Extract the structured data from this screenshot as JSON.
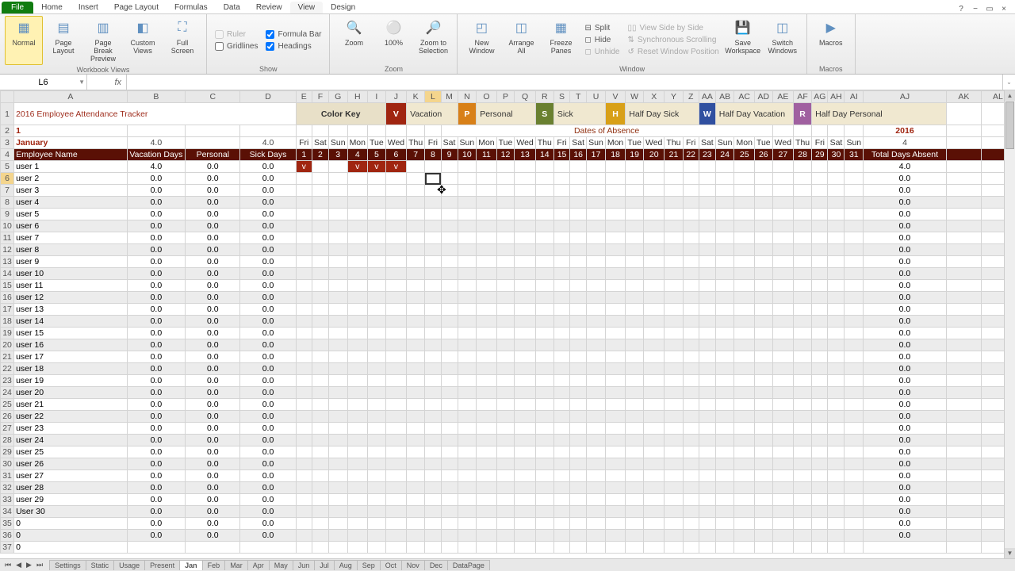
{
  "tabs": [
    "File",
    "Home",
    "Insert",
    "Page Layout",
    "Formulas",
    "Data",
    "Review",
    "View",
    "Design"
  ],
  "active_tab": "View",
  "ribbon": {
    "workbook_views": {
      "label": "Workbook Views",
      "normal": "Normal",
      "page_layout": "Page\nLayout",
      "page_break": "Page Break\nPreview",
      "custom": "Custom\nViews",
      "full": "Full\nScreen"
    },
    "show": {
      "label": "Show",
      "ruler": "Ruler",
      "formula_bar": "Formula Bar",
      "gridlines": "Gridlines",
      "headings": "Headings"
    },
    "zoom": {
      "label": "Zoom",
      "zoom": "Zoom",
      "hundred": "100%",
      "to_sel": "Zoom to\nSelection"
    },
    "window": {
      "label": "Window",
      "new": "New\nWindow",
      "arrange": "Arrange\nAll",
      "freeze": "Freeze\nPanes",
      "split": "Split",
      "hide": "Hide",
      "unhide": "Unhide",
      "side": "View Side by Side",
      "sync": "Synchronous Scrolling",
      "reset": "Reset Window Position",
      "save": "Save\nWorkspace",
      "switch": "Switch\nWindows"
    },
    "macros": {
      "label": "Macros",
      "macros": "Macros"
    }
  },
  "namebox": "L6",
  "formula": "",
  "cols": [
    "A",
    "B",
    "C",
    "D",
    "E",
    "F",
    "G",
    "H",
    "I",
    "J",
    "K",
    "L",
    "M",
    "N",
    "O",
    "P",
    "Q",
    "R",
    "S",
    "T",
    "U",
    "V",
    "W",
    "X",
    "Y",
    "Z",
    "AA",
    "AB",
    "AC",
    "AD",
    "AE",
    "AF",
    "AG",
    "AH",
    "AI",
    "AJ",
    "AK",
    "AL"
  ],
  "title": "2016 Employee Attendance Tracker",
  "color_key": "Color Key",
  "keys": [
    {
      "code": "V",
      "label": "Vacation",
      "cls": "key-v"
    },
    {
      "code": "P",
      "label": "Personal",
      "cls": "key-p"
    },
    {
      "code": "S",
      "label": "Sick",
      "cls": "key-s"
    },
    {
      "code": "H",
      "label": "Half Day Sick",
      "cls": "key-h"
    },
    {
      "code": "W",
      "label": "Half Day Vacation",
      "cls": "key-w"
    },
    {
      "code": "R",
      "label": "Half Day Personal",
      "cls": "key-r"
    }
  ],
  "monthnum": "1",
  "monthname": "January",
  "dates_header": "Dates of Absence",
  "year": "2016",
  "floats": {
    "b": "4.0",
    "d": "4.0",
    "aj": "4"
  },
  "dow": [
    "Fri",
    "Sat",
    "Sun",
    "Mon",
    "Tue",
    "Wed",
    "Thu",
    "Fri",
    "Sat",
    "Sun",
    "Mon",
    "Tue",
    "Wed",
    "Thu",
    "Fri",
    "Sat",
    "Sun",
    "Mon",
    "Tue",
    "Wed",
    "Thu",
    "Fri",
    "Sat",
    "Sun",
    "Mon",
    "Tue",
    "Wed",
    "Thu",
    "Fri",
    "Sat",
    "Sun"
  ],
  "headers": {
    "name": "Employee Name",
    "vac": "Vacation Days",
    "per": "Personal",
    "sick": "Sick Days",
    "total": "Total Days Absent"
  },
  "days": [
    "1",
    "2",
    "3",
    "4",
    "5",
    "6",
    "7",
    "8",
    "9",
    "10",
    "11",
    "12",
    "13",
    "14",
    "15",
    "16",
    "17",
    "18",
    "19",
    "20",
    "21",
    "22",
    "23",
    "24",
    "25",
    "26",
    "27",
    "28",
    "29",
    "30",
    "31"
  ],
  "rows": [
    {
      "r": 5,
      "name": "user 1",
      "vac": "4.0",
      "per": "0.0",
      "sick": "0.0",
      "marks": {
        "0": "v",
        "3": "v",
        "4": "v",
        "5": "v"
      },
      "total": "4.0"
    },
    {
      "r": 6,
      "name": "user 2",
      "vac": "0.0",
      "per": "0.0",
      "sick": "0.0",
      "marks": {},
      "total": "0.0",
      "sel": true
    },
    {
      "r": 7,
      "name": "user 3",
      "vac": "0.0",
      "per": "0.0",
      "sick": "0.0",
      "marks": {},
      "total": "0.0"
    },
    {
      "r": 8,
      "name": "user 4",
      "vac": "0.0",
      "per": "0.0",
      "sick": "0.0",
      "marks": {},
      "total": "0.0"
    },
    {
      "r": 9,
      "name": "user 5",
      "vac": "0.0",
      "per": "0.0",
      "sick": "0.0",
      "marks": {},
      "total": "0.0"
    },
    {
      "r": 10,
      "name": "user 6",
      "vac": "0.0",
      "per": "0.0",
      "sick": "0.0",
      "marks": {},
      "total": "0.0"
    },
    {
      "r": 11,
      "name": "user 7",
      "vac": "0.0",
      "per": "0.0",
      "sick": "0.0",
      "marks": {},
      "total": "0.0"
    },
    {
      "r": 12,
      "name": "user 8",
      "vac": "0.0",
      "per": "0.0",
      "sick": "0.0",
      "marks": {},
      "total": "0.0"
    },
    {
      "r": 13,
      "name": "user 9",
      "vac": "0.0",
      "per": "0.0",
      "sick": "0.0",
      "marks": {},
      "total": "0.0"
    },
    {
      "r": 14,
      "name": "user 10",
      "vac": "0.0",
      "per": "0.0",
      "sick": "0.0",
      "marks": {},
      "total": "0.0"
    },
    {
      "r": 15,
      "name": "user 11",
      "vac": "0.0",
      "per": "0.0",
      "sick": "0.0",
      "marks": {},
      "total": "0.0"
    },
    {
      "r": 16,
      "name": "user 12",
      "vac": "0.0",
      "per": "0.0",
      "sick": "0.0",
      "marks": {},
      "total": "0.0"
    },
    {
      "r": 17,
      "name": "user 13",
      "vac": "0.0",
      "per": "0.0",
      "sick": "0.0",
      "marks": {},
      "total": "0.0"
    },
    {
      "r": 18,
      "name": "user 14",
      "vac": "0.0",
      "per": "0.0",
      "sick": "0.0",
      "marks": {},
      "total": "0.0"
    },
    {
      "r": 19,
      "name": "user 15",
      "vac": "0.0",
      "per": "0.0",
      "sick": "0.0",
      "marks": {},
      "total": "0.0"
    },
    {
      "r": 20,
      "name": "user 16",
      "vac": "0.0",
      "per": "0.0",
      "sick": "0.0",
      "marks": {},
      "total": "0.0"
    },
    {
      "r": 21,
      "name": "user 17",
      "vac": "0.0",
      "per": "0.0",
      "sick": "0.0",
      "marks": {},
      "total": "0.0"
    },
    {
      "r": 22,
      "name": "user 18",
      "vac": "0.0",
      "per": "0.0",
      "sick": "0.0",
      "marks": {},
      "total": "0.0"
    },
    {
      "r": 23,
      "name": "user 19",
      "vac": "0.0",
      "per": "0.0",
      "sick": "0.0",
      "marks": {},
      "total": "0.0"
    },
    {
      "r": 24,
      "name": "user 20",
      "vac": "0.0",
      "per": "0.0",
      "sick": "0.0",
      "marks": {},
      "total": "0.0"
    },
    {
      "r": 25,
      "name": "user 21",
      "vac": "0.0",
      "per": "0.0",
      "sick": "0.0",
      "marks": {},
      "total": "0.0"
    },
    {
      "r": 26,
      "name": "user 22",
      "vac": "0.0",
      "per": "0.0",
      "sick": "0.0",
      "marks": {},
      "total": "0.0"
    },
    {
      "r": 27,
      "name": "user 23",
      "vac": "0.0",
      "per": "0.0",
      "sick": "0.0",
      "marks": {},
      "total": "0.0"
    },
    {
      "r": 28,
      "name": "user 24",
      "vac": "0.0",
      "per": "0.0",
      "sick": "0.0",
      "marks": {},
      "total": "0.0"
    },
    {
      "r": 29,
      "name": "user 25",
      "vac": "0.0",
      "per": "0.0",
      "sick": "0.0",
      "marks": {},
      "total": "0.0"
    },
    {
      "r": 30,
      "name": "user 26",
      "vac": "0.0",
      "per": "0.0",
      "sick": "0.0",
      "marks": {},
      "total": "0.0"
    },
    {
      "r": 31,
      "name": "user 27",
      "vac": "0.0",
      "per": "0.0",
      "sick": "0.0",
      "marks": {},
      "total": "0.0"
    },
    {
      "r": 32,
      "name": "user 28",
      "vac": "0.0",
      "per": "0.0",
      "sick": "0.0",
      "marks": {},
      "total": "0.0"
    },
    {
      "r": 33,
      "name": "user 29",
      "vac": "0.0",
      "per": "0.0",
      "sick": "0.0",
      "marks": {},
      "total": "0.0"
    },
    {
      "r": 34,
      "name": "User 30",
      "vac": "0.0",
      "per": "0.0",
      "sick": "0.0",
      "marks": {},
      "total": "0.0"
    },
    {
      "r": 35,
      "name": "0",
      "vac": "0.0",
      "per": "0.0",
      "sick": "0.0",
      "marks": {},
      "total": "0.0"
    },
    {
      "r": 36,
      "name": "0",
      "vac": "0.0",
      "per": "0.0",
      "sick": "0.0",
      "marks": {},
      "total": "0.0"
    },
    {
      "r": 37,
      "name": "0",
      "vac": "",
      "per": "",
      "sick": "",
      "marks": {},
      "total": ""
    }
  ],
  "sheet_tabs": [
    "Settings",
    "Static",
    "Usage",
    "Present",
    "Jan",
    "Feb",
    "Mar",
    "Apr",
    "May",
    "Jun",
    "Jul",
    "Aug",
    "Sep",
    "Oct",
    "Nov",
    "Dec",
    "DataPage"
  ],
  "active_sheet": "Jan"
}
